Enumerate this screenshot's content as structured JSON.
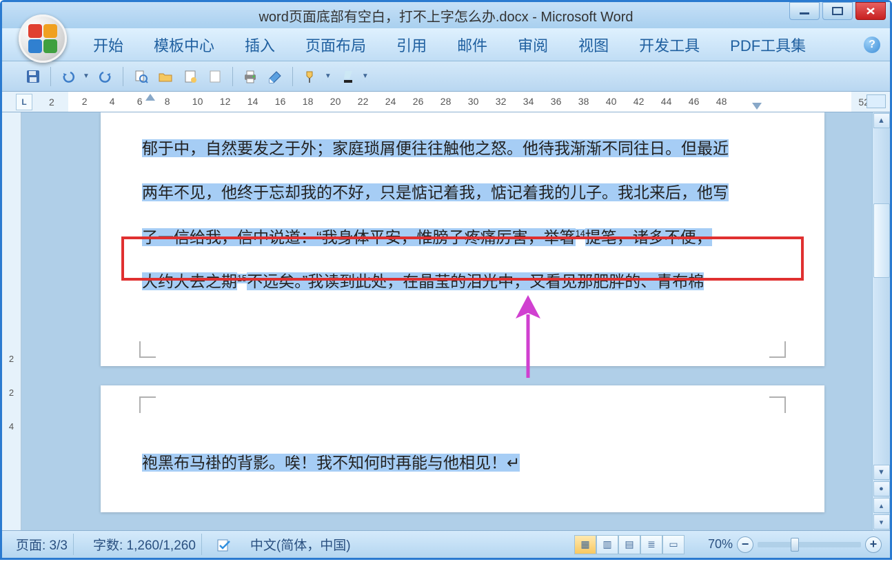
{
  "title": "word页面底部有空白，打不上字怎么办.docx - Microsoft Word",
  "menu": {
    "items": [
      "开始",
      "模板中心",
      "插入",
      "页面布局",
      "引用",
      "邮件",
      "审阅",
      "视图",
      "开发工具",
      "PDF工具集"
    ]
  },
  "ruler": {
    "left_marker": "L",
    "left_value": "2",
    "ticks": [
      "2",
      "4",
      "6",
      "8",
      "10",
      "12",
      "14",
      "16",
      "18",
      "20",
      "22",
      "24",
      "26",
      "28",
      "30",
      "32",
      "34",
      "36",
      "38",
      "40",
      "42",
      "44",
      "46",
      "48"
    ],
    "right_value": "52"
  },
  "vruler": {
    "ticks": [
      "2",
      "2",
      "4"
    ]
  },
  "doc": {
    "p1_l1": "郁于中，自然要发之于外；家庭琐屑便往往触他之怒。他待我渐渐不同往日。但最近",
    "p1_l2": "两年不见，他终于忘却我的不好，只是惦记着我，惦记着我的儿子。我北来后，他写",
    "p1_l3_a": "了一信给我，信中说道：“我身体平安，惟膀子疼痛厉害，举箸",
    "p1_l3_sup": "14",
    "p1_l3_b": "提笔，诸多不便，",
    "p1_l4_a": "大约大去之期",
    "p1_l4_sup": "15",
    "p1_l4_b": "不远矣。”我读到此处，在晶莹的泪光中，又看见那肥胖的、青布棉",
    "p2_l1": "袍黑布马褂的背影。唉！我不知何时再能与他相见！↵"
  },
  "status": {
    "page": "页面: 3/3",
    "words": "字数: 1,260/1,260",
    "lang": "中文(简体，中国)",
    "zoom": "70%"
  }
}
